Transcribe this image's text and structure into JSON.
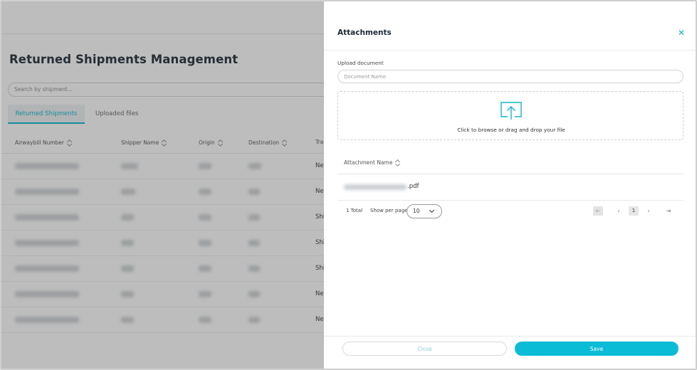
{
  "page": {
    "title": "Returned Shipments Management",
    "search_placeholder": "Search by shipment...",
    "tabs": [
      {
        "label": "Returned Shipments",
        "active": true
      },
      {
        "label": "Uploaded files",
        "active": false
      }
    ],
    "columns": [
      "Airwaybill Number",
      "Shipper Name",
      "Origin",
      "Destination",
      "Tra"
    ],
    "rows": [
      {
        "tracking": "Ne"
      },
      {
        "tracking": "Ne"
      },
      {
        "tracking": "Shi"
      },
      {
        "tracking": "Shi"
      },
      {
        "tracking": "Shi"
      },
      {
        "tracking": "Ne"
      },
      {
        "tracking": "Ne"
      }
    ]
  },
  "modal": {
    "title": "Attachments",
    "close_icon": "close-icon",
    "upload_label": "Upload document",
    "document_name_placeholder": "Document Name",
    "dropzone_text": "Click to browse or drag and drop your file",
    "upload_icon": "upload-icon",
    "table_header": "Attachment Name",
    "attachments": [
      {
        "extension": ".pdf"
      }
    ],
    "pagination": {
      "total": "1 Total",
      "show_per_page_label": "Show per page",
      "per_page_value": "10",
      "current_page": "1"
    },
    "footer": {
      "close_label": "Close",
      "save_label": "Save"
    }
  },
  "colors": {
    "accent": "#0bbcd6",
    "title": "#1e2a35",
    "overlay": "rgba(55,55,55,0.33)"
  }
}
